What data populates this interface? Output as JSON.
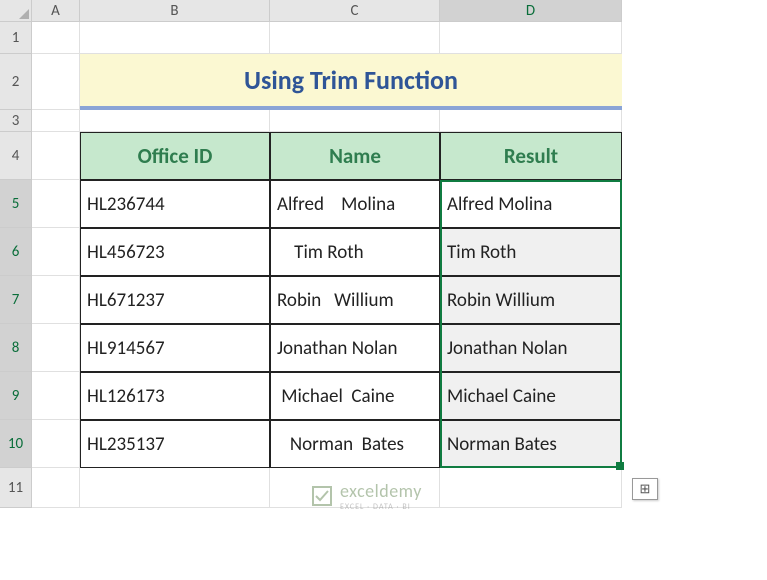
{
  "columns": [
    "A",
    "B",
    "C",
    "D"
  ],
  "active_column_index": 3,
  "rows": [
    "1",
    "2",
    "3",
    "4",
    "5",
    "6",
    "7",
    "8",
    "9",
    "10",
    "11"
  ],
  "active_row_start": 4,
  "active_row_end": 9,
  "title": "Using Trim Function",
  "headers": {
    "b": "Office ID",
    "c": "Name",
    "d": "Result"
  },
  "data": [
    {
      "id": "HL236744",
      "name": "Alfred    Molina",
      "result": "Alfred Molina"
    },
    {
      "id": "HL456723",
      "name": "    Tim Roth",
      "result": "Tim Roth"
    },
    {
      "id": "HL671237",
      "name": "Robin   Willium",
      "result": "Robin Willium"
    },
    {
      "id": "HL914567",
      "name": "Jonathan Nolan",
      "result": "Jonathan Nolan"
    },
    {
      "id": "HL126173",
      "name": " Michael  Caine",
      "result": "Michael Caine"
    },
    {
      "id": "HL235137",
      "name": "   Norman  Bates",
      "result": "Norman Bates"
    }
  ],
  "watermark": {
    "name": "exceldemy",
    "tagline": "EXCEL · DATA · BI"
  },
  "autofill_icon": "⊞",
  "chart_data": {
    "type": "table",
    "title": "Using Trim Function",
    "columns": [
      "Office ID",
      "Name",
      "Result"
    ],
    "rows": [
      [
        "HL236744",
        "Alfred    Molina",
        "Alfred Molina"
      ],
      [
        "HL456723",
        "    Tim Roth",
        "Tim Roth"
      ],
      [
        "HL671237",
        "Robin   Willium",
        "Robin Willium"
      ],
      [
        "HL914567",
        "Jonathan Nolan",
        "Jonathan Nolan"
      ],
      [
        "HL126173",
        " Michael  Caine",
        "Michael Caine"
      ],
      [
        "HL235137",
        "   Norman  Bates",
        "Norman Bates"
      ]
    ]
  }
}
